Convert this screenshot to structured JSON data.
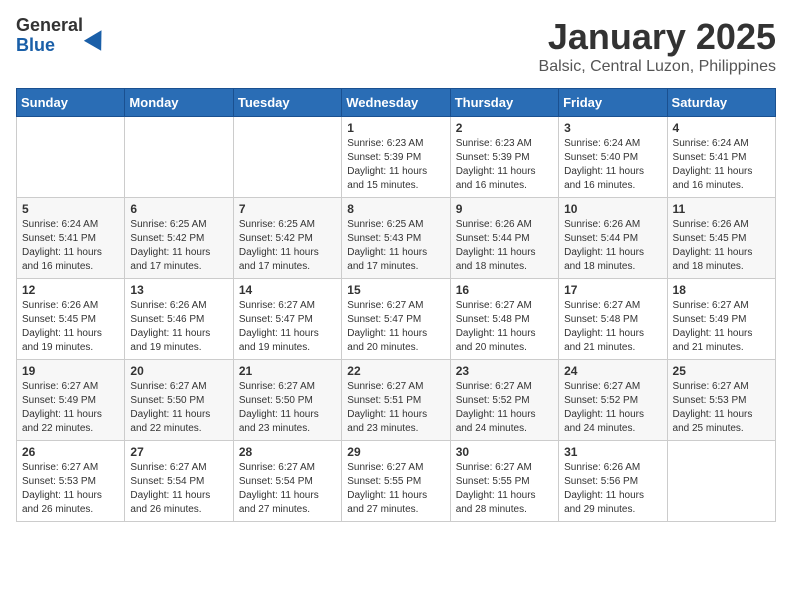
{
  "header": {
    "logo_general": "General",
    "logo_blue": "Blue",
    "month_title": "January 2025",
    "location": "Balsic, Central Luzon, Philippines"
  },
  "weekdays": [
    "Sunday",
    "Monday",
    "Tuesday",
    "Wednesday",
    "Thursday",
    "Friday",
    "Saturday"
  ],
  "weeks": [
    [
      {
        "day": "",
        "sunrise": "",
        "sunset": "",
        "daylight": ""
      },
      {
        "day": "",
        "sunrise": "",
        "sunset": "",
        "daylight": ""
      },
      {
        "day": "",
        "sunrise": "",
        "sunset": "",
        "daylight": ""
      },
      {
        "day": "1",
        "sunrise": "Sunrise: 6:23 AM",
        "sunset": "Sunset: 5:39 PM",
        "daylight": "Daylight: 11 hours and 15 minutes."
      },
      {
        "day": "2",
        "sunrise": "Sunrise: 6:23 AM",
        "sunset": "Sunset: 5:39 PM",
        "daylight": "Daylight: 11 hours and 16 minutes."
      },
      {
        "day": "3",
        "sunrise": "Sunrise: 6:24 AM",
        "sunset": "Sunset: 5:40 PM",
        "daylight": "Daylight: 11 hours and 16 minutes."
      },
      {
        "day": "4",
        "sunrise": "Sunrise: 6:24 AM",
        "sunset": "Sunset: 5:41 PM",
        "daylight": "Daylight: 11 hours and 16 minutes."
      }
    ],
    [
      {
        "day": "5",
        "sunrise": "Sunrise: 6:24 AM",
        "sunset": "Sunset: 5:41 PM",
        "daylight": "Daylight: 11 hours and 16 minutes."
      },
      {
        "day": "6",
        "sunrise": "Sunrise: 6:25 AM",
        "sunset": "Sunset: 5:42 PM",
        "daylight": "Daylight: 11 hours and 17 minutes."
      },
      {
        "day": "7",
        "sunrise": "Sunrise: 6:25 AM",
        "sunset": "Sunset: 5:42 PM",
        "daylight": "Daylight: 11 hours and 17 minutes."
      },
      {
        "day": "8",
        "sunrise": "Sunrise: 6:25 AM",
        "sunset": "Sunset: 5:43 PM",
        "daylight": "Daylight: 11 hours and 17 minutes."
      },
      {
        "day": "9",
        "sunrise": "Sunrise: 6:26 AM",
        "sunset": "Sunset: 5:44 PM",
        "daylight": "Daylight: 11 hours and 18 minutes."
      },
      {
        "day": "10",
        "sunrise": "Sunrise: 6:26 AM",
        "sunset": "Sunset: 5:44 PM",
        "daylight": "Daylight: 11 hours and 18 minutes."
      },
      {
        "day": "11",
        "sunrise": "Sunrise: 6:26 AM",
        "sunset": "Sunset: 5:45 PM",
        "daylight": "Daylight: 11 hours and 18 minutes."
      }
    ],
    [
      {
        "day": "12",
        "sunrise": "Sunrise: 6:26 AM",
        "sunset": "Sunset: 5:45 PM",
        "daylight": "Daylight: 11 hours and 19 minutes."
      },
      {
        "day": "13",
        "sunrise": "Sunrise: 6:26 AM",
        "sunset": "Sunset: 5:46 PM",
        "daylight": "Daylight: 11 hours and 19 minutes."
      },
      {
        "day": "14",
        "sunrise": "Sunrise: 6:27 AM",
        "sunset": "Sunset: 5:47 PM",
        "daylight": "Daylight: 11 hours and 19 minutes."
      },
      {
        "day": "15",
        "sunrise": "Sunrise: 6:27 AM",
        "sunset": "Sunset: 5:47 PM",
        "daylight": "Daylight: 11 hours and 20 minutes."
      },
      {
        "day": "16",
        "sunrise": "Sunrise: 6:27 AM",
        "sunset": "Sunset: 5:48 PM",
        "daylight": "Daylight: 11 hours and 20 minutes."
      },
      {
        "day": "17",
        "sunrise": "Sunrise: 6:27 AM",
        "sunset": "Sunset: 5:48 PM",
        "daylight": "Daylight: 11 hours and 21 minutes."
      },
      {
        "day": "18",
        "sunrise": "Sunrise: 6:27 AM",
        "sunset": "Sunset: 5:49 PM",
        "daylight": "Daylight: 11 hours and 21 minutes."
      }
    ],
    [
      {
        "day": "19",
        "sunrise": "Sunrise: 6:27 AM",
        "sunset": "Sunset: 5:49 PM",
        "daylight": "Daylight: 11 hours and 22 minutes."
      },
      {
        "day": "20",
        "sunrise": "Sunrise: 6:27 AM",
        "sunset": "Sunset: 5:50 PM",
        "daylight": "Daylight: 11 hours and 22 minutes."
      },
      {
        "day": "21",
        "sunrise": "Sunrise: 6:27 AM",
        "sunset": "Sunset: 5:50 PM",
        "daylight": "Daylight: 11 hours and 23 minutes."
      },
      {
        "day": "22",
        "sunrise": "Sunrise: 6:27 AM",
        "sunset": "Sunset: 5:51 PM",
        "daylight": "Daylight: 11 hours and 23 minutes."
      },
      {
        "day": "23",
        "sunrise": "Sunrise: 6:27 AM",
        "sunset": "Sunset: 5:52 PM",
        "daylight": "Daylight: 11 hours and 24 minutes."
      },
      {
        "day": "24",
        "sunrise": "Sunrise: 6:27 AM",
        "sunset": "Sunset: 5:52 PM",
        "daylight": "Daylight: 11 hours and 24 minutes."
      },
      {
        "day": "25",
        "sunrise": "Sunrise: 6:27 AM",
        "sunset": "Sunset: 5:53 PM",
        "daylight": "Daylight: 11 hours and 25 minutes."
      }
    ],
    [
      {
        "day": "26",
        "sunrise": "Sunrise: 6:27 AM",
        "sunset": "Sunset: 5:53 PM",
        "daylight": "Daylight: 11 hours and 26 minutes."
      },
      {
        "day": "27",
        "sunrise": "Sunrise: 6:27 AM",
        "sunset": "Sunset: 5:54 PM",
        "daylight": "Daylight: 11 hours and 26 minutes."
      },
      {
        "day": "28",
        "sunrise": "Sunrise: 6:27 AM",
        "sunset": "Sunset: 5:54 PM",
        "daylight": "Daylight: 11 hours and 27 minutes."
      },
      {
        "day": "29",
        "sunrise": "Sunrise: 6:27 AM",
        "sunset": "Sunset: 5:55 PM",
        "daylight": "Daylight: 11 hours and 27 minutes."
      },
      {
        "day": "30",
        "sunrise": "Sunrise: 6:27 AM",
        "sunset": "Sunset: 5:55 PM",
        "daylight": "Daylight: 11 hours and 28 minutes."
      },
      {
        "day": "31",
        "sunrise": "Sunrise: 6:26 AM",
        "sunset": "Sunset: 5:56 PM",
        "daylight": "Daylight: 11 hours and 29 minutes."
      },
      {
        "day": "",
        "sunrise": "",
        "sunset": "",
        "daylight": ""
      }
    ]
  ]
}
